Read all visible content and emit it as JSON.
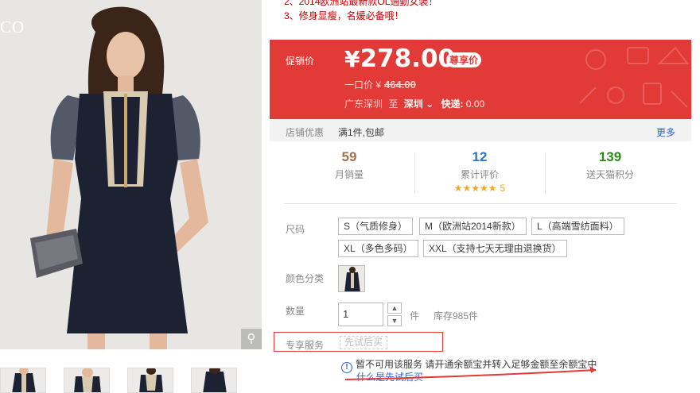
{
  "gallery": {
    "brand_text": "CO",
    "zoom_icon": "search-icon",
    "thumbs": [
      "thumb-1",
      "thumb-2",
      "thumb-3",
      "thumb-4"
    ]
  },
  "description": [
    "2、2014欧洲站最新款OL通勤女装！",
    "3、修身显瘦，名媛必备哦！"
  ],
  "price": {
    "label": "促销价",
    "currency": "¥",
    "value": "278.00",
    "vip_tag": "尊享价",
    "original_label": "一口价",
    "original_currency": "¥",
    "original_value": "464.00",
    "ship_from": "广东深圳",
    "ship_to_label": "至",
    "ship_to": "深圳",
    "fee_label": "快递:",
    "fee": "0.00",
    "accent_color": "#e23a36"
  },
  "shop_promo": {
    "label": "店铺优惠",
    "text": "满1件,包邮",
    "more": "更多"
  },
  "stats": [
    {
      "value": "59",
      "label": "月销量",
      "color": "#a0724a"
    },
    {
      "value": "12",
      "label": "累计评价",
      "color": "#2b78c4",
      "stars": "★★★★★",
      "rating": "5"
    },
    {
      "value": "139",
      "label": "送天猫积分",
      "color": "#2f8a1f"
    }
  ],
  "size": {
    "label": "尺码",
    "options": [
      "S（气质修身）",
      "M（欧洲站2014新款）",
      "L（高端雪纺面料）",
      "XL（多色多码）",
      "XXL（支持七天无理由退换货）"
    ]
  },
  "color": {
    "label": "颜色分类"
  },
  "quantity": {
    "label": "数量",
    "value": "1",
    "unit": "件",
    "stock": "库存985件"
  },
  "service": {
    "label": "专享服务",
    "option": "先试后买",
    "notice": "暂不可用该服务 请开通余额宝并转入足够金额至余额宝中",
    "link": "什么是先试后买"
  }
}
